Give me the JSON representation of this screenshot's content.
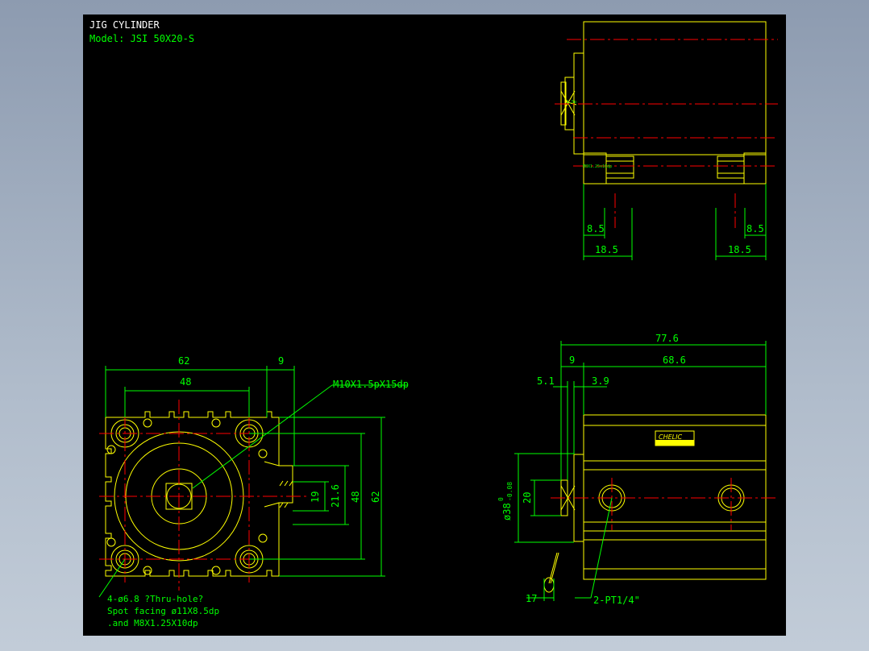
{
  "title": {
    "line1": "JIG CYLINDER",
    "line2": "Model: JSI 50X20-S"
  },
  "colors": {
    "background": "#000000",
    "outline": "#ffff00",
    "dimension": "#00ff00",
    "centerline": "#ff0000",
    "title": "#ffffff"
  },
  "top_view": {
    "dims": {
      "left_small": "8.5",
      "left_large": "18.5",
      "right_small": "8.5",
      "right_large": "18.5"
    }
  },
  "front_view": {
    "dims": {
      "width_outer": "62",
      "width_inner": "48",
      "flat_offset": "9",
      "height_19": "19",
      "height_21_6": "21.6",
      "height_48": "48",
      "height_62": "62"
    },
    "thread_note": "M10X1.5pX15dp",
    "hole_note": {
      "line1": "4-ø6.8   ?Thru-hole?",
      "line2": "Spot facing  ø11X8.5dp",
      "line3": ".and M8X1.25X10dp"
    }
  },
  "side_view": {
    "dims": {
      "overall": "77.6",
      "body": "68.6",
      "rod": "9",
      "d1": "5.1",
      "d2": "3.9",
      "rod_dia": "20",
      "bore": "ø38",
      "bore_tol_upper": "0",
      "bore_tol_lower": "-0.08",
      "tip": "17"
    },
    "port_note": "2-PT1/4\"",
    "brand": "CHELIC"
  }
}
